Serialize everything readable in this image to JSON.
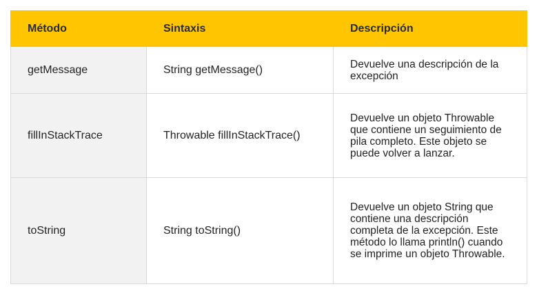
{
  "table": {
    "headers": [
      "Método",
      "Sintaxis",
      "Descripción"
    ],
    "rows": [
      {
        "method": "getMessage",
        "syntax": "String getMessage()",
        "description": "Devuelve una descripción de la excepción"
      },
      {
        "method": "fillInStackTrace",
        "syntax": "Throwable fillInStackTrace()",
        "description": "Devuelve un objeto Throwable que contiene un seguimiento de pila completo. Este objeto se puede volver a lanzar."
      },
      {
        "method": "toString",
        "syntax": "String toString()",
        "description": "Devuelve un objeto String que contiene una descripción completa de la excepción. Este método lo llama println() cuando se imprime un objeto Throwable."
      }
    ]
  },
  "colors": {
    "header_bg": "#ffc600",
    "method_col_bg": "#f2f2f2",
    "border": "#d9d9d9"
  }
}
